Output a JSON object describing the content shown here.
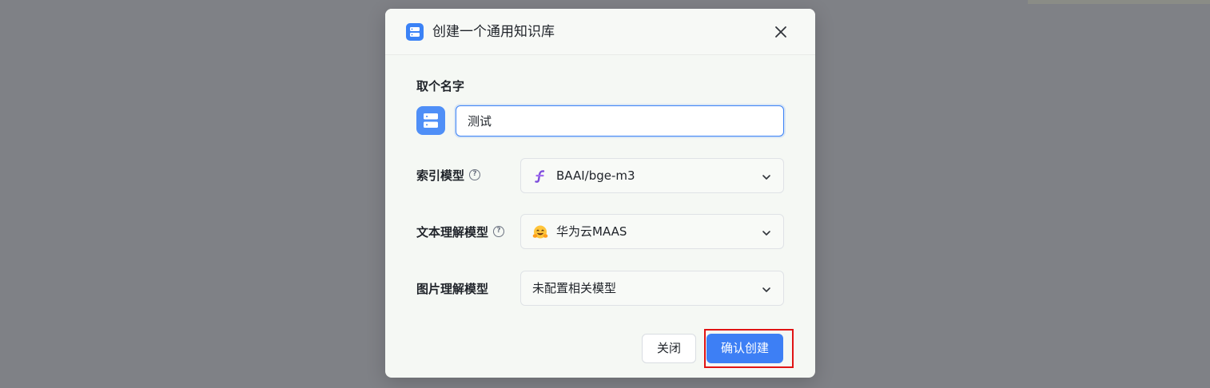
{
  "modal": {
    "title": "创建一个通用知识库",
    "name_label": "取个名字",
    "name_value": "测试",
    "index_model_label": "索引模型",
    "index_model_value": "BAAI/bge-m3",
    "text_model_label": "文本理解模型",
    "text_model_value": "华为云MAAS",
    "image_model_label": "图片理解模型",
    "image_model_value": "未配置相关模型",
    "close_label": "关闭",
    "confirm_label": "确认创建"
  },
  "icons": {
    "header": "database-icon",
    "close": "close-icon",
    "help": "question-circle-icon",
    "index_model": "siliconflow-icon",
    "text_model": "hugging-face-emoji-icon",
    "chevron": "chevron-down-icon"
  },
  "colors": {
    "accent": "#3b82f6",
    "confirm_button": "#3d7ff5",
    "highlight_box": "#e01414"
  }
}
